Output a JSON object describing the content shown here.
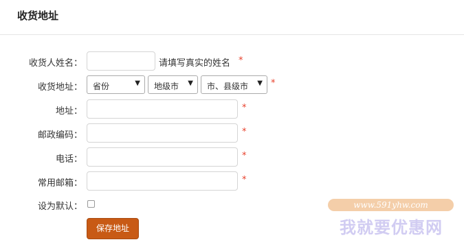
{
  "header": {
    "title": "收货地址"
  },
  "form": {
    "name": {
      "label": "收货人姓名：",
      "value": "",
      "hint": "请填写真实的姓名",
      "required": "*"
    },
    "region": {
      "label": "收货地址：",
      "province": "省份",
      "city": "地级市",
      "county": "市、县级市",
      "required": "*"
    },
    "address": {
      "label": "地址：",
      "value": "",
      "required": "*"
    },
    "postcode": {
      "label": "邮政编码：",
      "value": "",
      "required": "*"
    },
    "phone": {
      "label": "电话：",
      "value": "",
      "required": "*"
    },
    "email": {
      "label": "常用邮箱：",
      "value": "",
      "required": "*"
    },
    "default": {
      "label": "设为默认：",
      "checked": false
    },
    "save_label": "保存地址"
  },
  "watermark": {
    "url": "www.591yhw.com",
    "name": "我就要优惠网"
  },
  "colors": {
    "accent": "#c85a15",
    "required": "#e8412c"
  }
}
